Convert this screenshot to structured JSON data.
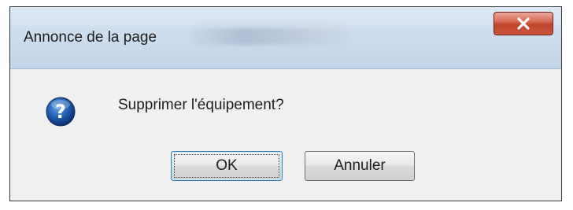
{
  "dialog": {
    "title": "Annonce de la page",
    "message": "Supprimer l'équipement?",
    "close_icon": "close-icon",
    "message_icon": "question-icon"
  },
  "buttons": {
    "ok_label": "OK",
    "cancel_label": "Annuler"
  },
  "colors": {
    "titlebar": "#cfdeef",
    "close_button": "#c9553d",
    "content_background": "#f0f0f0",
    "icon_blue": "#1f5fb3"
  }
}
